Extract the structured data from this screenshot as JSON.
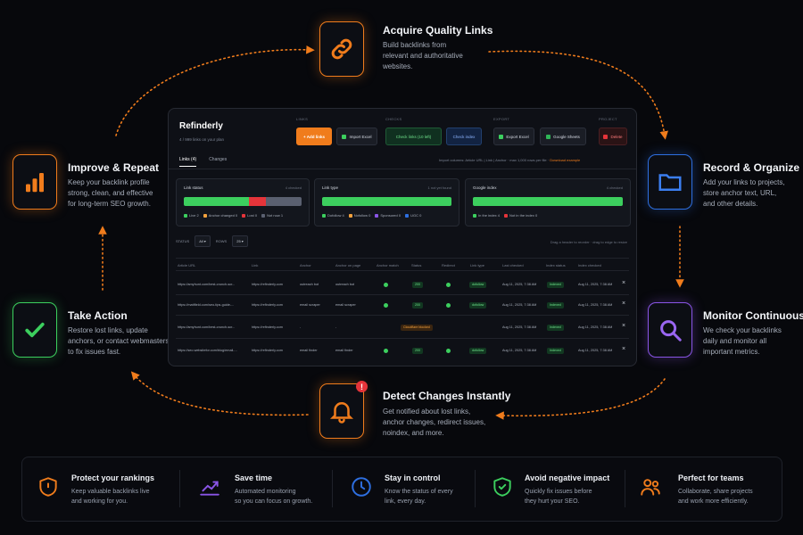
{
  "steps": {
    "acquire": {
      "title": "Acquire Quality Links",
      "desc": [
        "Build backlinks from",
        "relevant and authoritative",
        "websites."
      ],
      "icon": "link-icon",
      "color": "#f07c1c"
    },
    "record": {
      "title": "Record & Organize",
      "desc": [
        "Add your links to projects,",
        "store anchor text, URL,",
        "and other details."
      ],
      "icon": "folder-icon",
      "color": "#2e6fe0"
    },
    "monitor": {
      "title": "Monitor Continuously",
      "desc": [
        "We check your backlinks",
        "daily and monitor all",
        "important metrics."
      ],
      "icon": "magnifier-icon",
      "color": "#8a55e6"
    },
    "detect": {
      "title": "Detect Changes Instantly",
      "desc": [
        "Get notified about lost links,",
        "anchor changes, redirect issues,",
        "noindex, and more."
      ],
      "icon": "bell-alert-icon",
      "color": "#f07c1c",
      "badge": "!"
    },
    "action": {
      "title": "Take Action",
      "desc": [
        "Restore lost links, update",
        "anchors, or contact webmasters",
        "to fix issues fast."
      ],
      "icon": "checkmark-icon",
      "color": "#3ccf5e"
    },
    "improve": {
      "title": "Improve & Repeat",
      "desc": [
        "Keep your backlink profile",
        "strong, clean, and effective",
        "for long-term SEO growth."
      ],
      "icon": "bar-chart-icon",
      "color": "#f07c1c"
    }
  },
  "app": {
    "title": "Refinderly",
    "subtitle": "4 / 999 links on your plan",
    "groups": {
      "links": "LINKS",
      "checks": "CHECKS",
      "export": "EXPORT",
      "project": "PROJECT"
    },
    "buttons": {
      "add": "+ Add links",
      "import": "Import Excel",
      "check_links": "Check links (10 left)",
      "check_index": "Check index",
      "export_excel": "Export Excel",
      "google_sheets": "Google Sheets",
      "delete": "Delete"
    },
    "tabs": {
      "links": "Links (4)",
      "changes": "Changes"
    },
    "import_note": "Import columns: Article URL  |  Link  |  Anchor · max 1,000 rows per file ·",
    "download_example": "Download example",
    "cards": [
      {
        "title": "Link status",
        "count": "4 checked",
        "legend": [
          "Live 2",
          "Anchor changed 0",
          "Lost 0",
          "Not now 1"
        ]
      },
      {
        "title": "Link type",
        "count": "1 not yet found",
        "legend": [
          "Dofollow 4",
          "Nofollow 0",
          "Sponsored 0",
          "UGC 0"
        ]
      },
      {
        "title": "Google index",
        "count": "4 checked",
        "legend": [
          "In the index 4",
          "Not in the index 0"
        ]
      }
    ],
    "filters": {
      "status_label": "STATUS",
      "status_value": "All",
      "rows_label": "ROWS",
      "rows_value": "25"
    },
    "drag_hint": "Drag a header to reorder · drag to edge to resize",
    "columns": [
      "Article URL",
      "Link",
      "Anchor",
      "Anchor on page",
      "Anchor match",
      "Status",
      "Redirect",
      "Link type",
      "Last checked",
      "Index status",
      "Index checked"
    ],
    "rows": [
      {
        "article": "https://amyhunt.com/best-crunch-scr...",
        "link": "https://refinderly.com",
        "anchor": "outreach bot",
        "anchor_page": "outreach bot",
        "status": "200",
        "type": "dofollow",
        "checked": "Aug 11, 2025, 7:38 AM",
        "index": "Indexed",
        "index_checked": "Aug 11, 2025, 7:38 AM",
        "status_warn": false
      },
      {
        "article": "https://mattfield.com/seo-tips-guide-...",
        "link": "https://refinderly.com",
        "anchor": "email scraper",
        "anchor_page": "email scraper",
        "status": "200",
        "type": "dofollow",
        "checked": "Aug 11, 2025, 7:38 AM",
        "index": "Indexed",
        "index_checked": "Aug 11, 2025, 7:38 AM",
        "status_warn": false
      },
      {
        "article": "https://amyhunt.com/best-crunch-scr...",
        "link": "https://refinderly.com",
        "anchor": "-",
        "anchor_page": "-",
        "status": "Cloudflare blocked",
        "type": "",
        "checked": "Aug 11, 2025, 7:38 AM",
        "index": "Indexed",
        "index_checked": "Aug 11, 2025, 7:38 AM",
        "status_warn": true
      },
      {
        "article": "https://seo.websitefor.com/blog/email-...",
        "link": "https://refinderly.com",
        "anchor": "email finder",
        "anchor_page": "email finder",
        "status": "200",
        "type": "dofollow",
        "checked": "Aug 11, 2025, 7:38 AM",
        "index": "Indexed",
        "index_checked": "Aug 11, 2025, 7:38 AM",
        "status_warn": false
      }
    ]
  },
  "benefits": [
    {
      "title": "Protect your rankings",
      "desc": [
        "Keep valuable backlinks live",
        "and working for you."
      ],
      "icon": "shield-icon",
      "color": "#f07c1c"
    },
    {
      "title": "Save time",
      "desc": [
        "Automated monitoring",
        "so you can focus on growth."
      ],
      "icon": "trend-chart-icon",
      "color": "#8a55e6"
    },
    {
      "title": "Stay in control",
      "desc": [
        "Know the status of every",
        "link, every day."
      ],
      "icon": "clock-icon",
      "color": "#2e6fe0"
    },
    {
      "title": "Avoid negative impact",
      "desc": [
        "Quickly fix issues before",
        "they hurt your SEO."
      ],
      "icon": "shield-check-icon",
      "color": "#3ccf5e"
    },
    {
      "title": "Perfect for teams",
      "desc": [
        "Collaborate, share projects",
        "and work more efficiently."
      ],
      "icon": "team-icon",
      "color": "#f07c1c"
    }
  ]
}
